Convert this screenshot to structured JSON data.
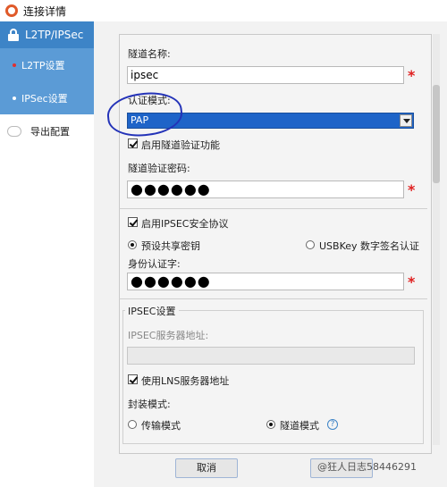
{
  "window": {
    "title": "连接详情"
  },
  "sidebar": {
    "header": "L2TP/IPSec",
    "items": [
      {
        "label": "L2TP设置"
      },
      {
        "label": "IPSec设置"
      }
    ],
    "export": "导出配置"
  },
  "form": {
    "tunnel_name_label": "隧道名称:",
    "tunnel_name_value": "ipsec",
    "auth_mode_label": "认证模式:",
    "auth_mode_value": "PAP",
    "enable_tunnel_auth_label": "启用隧道验证功能",
    "tunnel_password_label": "隧道验证密码:",
    "tunnel_password_value": "●●●●●●",
    "enable_ipsec_label": "启用IPSEC安全协议",
    "preshared_key_label": "预设共享密钥",
    "usbkey_label": "USBKey 数字签名认证",
    "identity_label": "身份认证字:",
    "identity_value": "●●●●●●",
    "ipsec_group_title": "IPSEC设置",
    "ipsec_server_label": "IPSEC服务器地址:",
    "ipsec_server_value": "",
    "use_lns_label": "使用LNS服务器地址",
    "encap_mode_label": "封装模式:",
    "transport_mode_label": "传输模式",
    "tunnel_mode_label": "隧道模式",
    "help_glyph": "?"
  },
  "required_mark": "*",
  "buttons": {
    "cancel": "取消"
  },
  "watermark": "@狂人日志58446291",
  "colors": {
    "accent": "#3d84c7",
    "select_bg": "#1e64c8",
    "required": "#e02020",
    "annotation": "#2433b8"
  }
}
